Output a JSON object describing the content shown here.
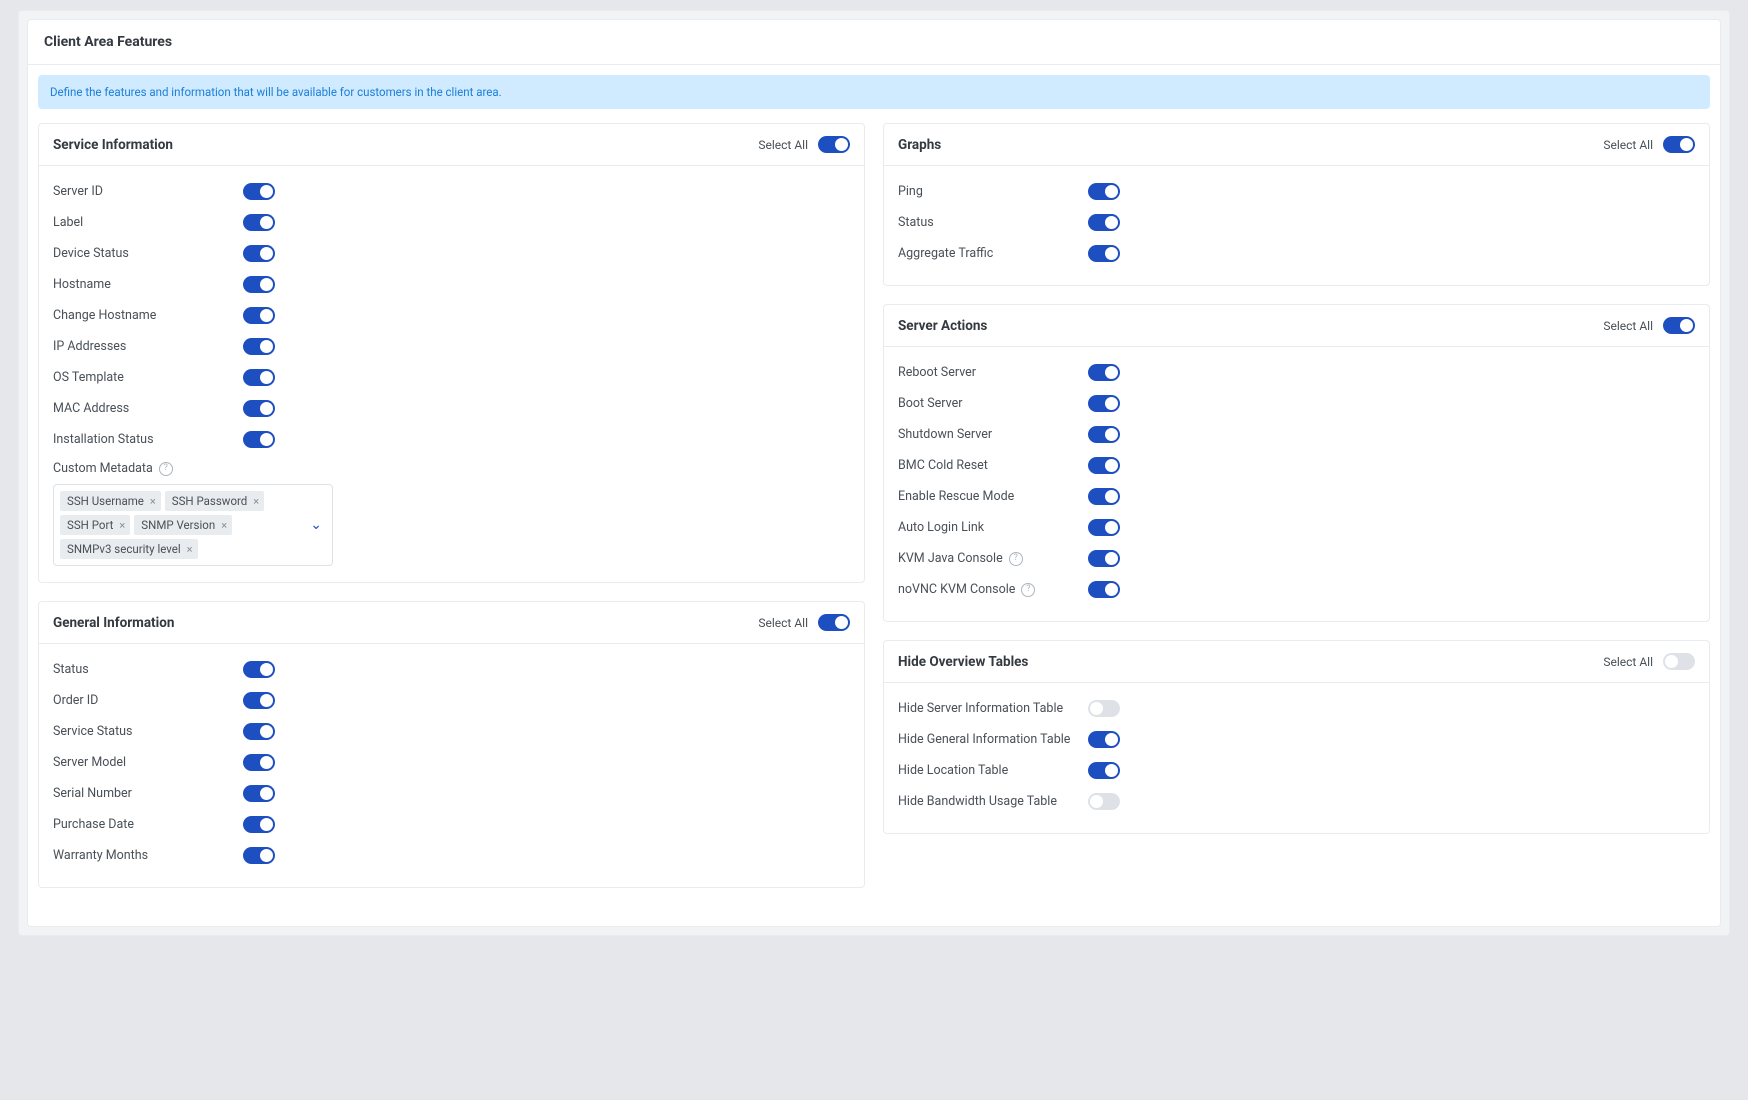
{
  "page": {
    "title": "Client Area Features",
    "info": "Define the features and information that will be available for customers in the client area.",
    "select_all_label": "Select All"
  },
  "cards": {
    "service_info": {
      "title": "Service Information",
      "select_all": true,
      "items": [
        {
          "label": "Server ID",
          "on": true
        },
        {
          "label": "Label",
          "on": true
        },
        {
          "label": "Device Status",
          "on": true
        },
        {
          "label": "Hostname",
          "on": true
        },
        {
          "label": "Change Hostname",
          "on": true
        },
        {
          "label": "IP Addresses",
          "on": true
        },
        {
          "label": "OS Template",
          "on": true
        },
        {
          "label": "MAC Address",
          "on": true
        },
        {
          "label": "Installation Status",
          "on": true
        }
      ],
      "custom_metadata": {
        "label": "Custom Metadata",
        "tags": [
          "SSH Username",
          "SSH Password",
          "SSH Port",
          "SNMP Version",
          "SNMPv3 security level"
        ]
      }
    },
    "general_info": {
      "title": "General Information",
      "select_all": true,
      "items": [
        {
          "label": "Status",
          "on": true
        },
        {
          "label": "Order ID",
          "on": true
        },
        {
          "label": "Service Status",
          "on": true
        },
        {
          "label": "Server Model",
          "on": true
        },
        {
          "label": "Serial Number",
          "on": true
        },
        {
          "label": "Purchase Date",
          "on": true
        },
        {
          "label": "Warranty Months",
          "on": true
        }
      ]
    },
    "graphs": {
      "title": "Graphs",
      "select_all": true,
      "items": [
        {
          "label": "Ping",
          "on": true
        },
        {
          "label": "Status",
          "on": true
        },
        {
          "label": "Aggregate Traffic",
          "on": true
        }
      ]
    },
    "server_actions": {
      "title": "Server Actions",
      "select_all": true,
      "items": [
        {
          "label": "Reboot Server",
          "on": true
        },
        {
          "label": "Boot Server",
          "on": true
        },
        {
          "label": "Shutdown Server",
          "on": true
        },
        {
          "label": "BMC Cold Reset",
          "on": true
        },
        {
          "label": "Enable Rescue Mode",
          "on": true
        },
        {
          "label": "Auto Login Link",
          "on": true
        },
        {
          "label": "KVM Java Console",
          "on": true,
          "help": true
        },
        {
          "label": "noVNC KVM Console",
          "on": true,
          "help": true
        }
      ]
    },
    "hide_tables": {
      "title": "Hide Overview Tables",
      "select_all": false,
      "items": [
        {
          "label": "Hide Server Information Table",
          "on": false
        },
        {
          "label": "Hide General Information Table",
          "on": true
        },
        {
          "label": "Hide Location Table",
          "on": true
        },
        {
          "label": "Hide Bandwidth Usage Table",
          "on": false
        }
      ]
    }
  }
}
